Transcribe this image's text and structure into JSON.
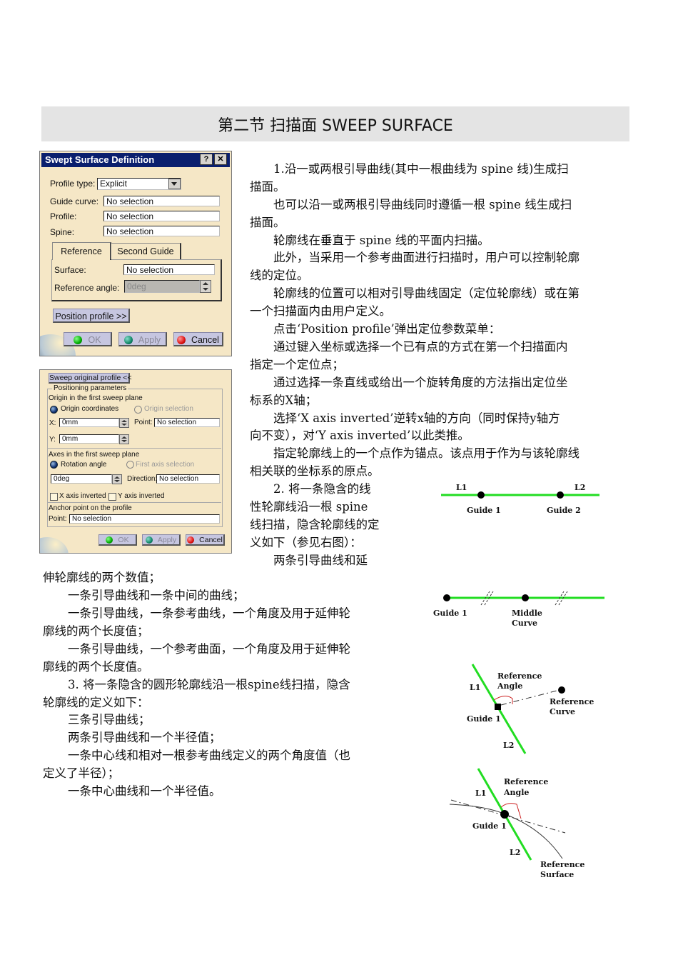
{
  "section_title": "第二节 扫描面 SWEEP SURFACE",
  "dialog1": {
    "title": "Swept Surface Definition",
    "help_button": "?",
    "close_button": "✕",
    "profile_type_label": "Profile type:",
    "profile_type_value": "Explicit",
    "guide_curve_label": "Guide curve:",
    "guide_curve_value": "No selection",
    "profile_label": "Profile:",
    "profile_value": "No selection",
    "spine_label": "Spine:",
    "spine_value": "No selection",
    "tabs": [
      {
        "label": "Reference",
        "active": true
      },
      {
        "label": "Second Guide",
        "active": false
      }
    ],
    "surface_label": "Surface:",
    "surface_value": "No selection",
    "ref_angle_label": "Reference angle:",
    "ref_angle_value": "0deg",
    "position_profile_button": "Position profile >>",
    "ok_button": "OK",
    "apply_button": "Apply",
    "cancel_button": "Cancel"
  },
  "dialog2": {
    "sweep_original_button": "Sweep original profile <<",
    "positioning_group": "Positioning parameters",
    "origin_heading": "Origin in the first sweep plane",
    "origin_coordinates_label": "Origin coordinates",
    "origin_selection_label": "Origin selection",
    "x_label": "X:",
    "x_value": "0mm",
    "y_label": "Y:",
    "y_value": "0mm",
    "point_label": "Point:",
    "point_value": "No selection",
    "axes_heading": "Axes in the first sweep plane",
    "rotation_angle_label": "Rotation angle",
    "first_axis_selection_label": "First axis selection",
    "angle_value": "0deg",
    "direction_label": "Direction:",
    "direction_value": "No selection",
    "x_inverted_label": "X axis inverted",
    "y_inverted_label": "Y axis inverted",
    "anchor_heading": "Anchor point on the profile",
    "anchor_point_label": "Point:",
    "anchor_point_value": "No selection",
    "ok_button": "OK",
    "apply_button": "Apply",
    "cancel_button": "Cancel"
  },
  "text": {
    "p1a": "1.沿一或两根引导曲线(其中一根曲线为 spine 线)生成扫",
    "p1b": "描面。",
    "p2a": "也可以沿一或两根引导曲线同时遵循一根 spine 线生成扫",
    "p2b": "描面。",
    "p3": "轮廓线在垂直于 spine 线的平面内扫描。",
    "p4a": "此外，当采用一个参考曲面进行扫描时，用户可以控制轮廓",
    "p4b": "线的定位。",
    "p5a": "轮廓线的位置可以相对引导曲线固定（定位轮廓线）或在第",
    "p5b": "一个扫描面内由用户定义。",
    "p6": "点击‘Position profile’弹出定位参数菜单：",
    "p7a": "通过键入坐标或选择一个已有点的方式在第一个扫描面内",
    "p7b": "指定一个定位点；",
    "p8a": "通过选择一条直线或给出一个旋转角度的方法指出定位坐",
    "p8b": "标系的X轴；",
    "p9a": "选择‘X axis inverted’逆转x轴的方向（同时保持y轴方",
    "p9b": "向不变），对‘Y axis inverted’以此类推。",
    "p10a": "指定轮廓线上的一个点作为锚点。该点用于作为与该轮廓线",
    "p10b": "相关联的坐标系的原点。",
    "p11a": "2. 将一条隐含的线",
    "p11b": "性轮廓线沿一根 spine",
    "p11c": "线扫描，隐含轮廓线的定",
    "p11d": "义如下（参见右图）：",
    "p12a": "两条引导曲线和延",
    "p12b": "伸轮廓线的两个数值；",
    "p13": "一条引导曲线和一条中间的曲线；",
    "p14a": "一条引导曲线，一条参考曲线，一个角度及用于延伸轮",
    "p14b": "廓线的两个长度值；",
    "p15a": "一条引导曲线，一个参考曲面，一个角度及用于延伸轮",
    "p15b": "廓线的两个长度值。",
    "p16a": "3. 将一条隐含的圆形轮廓线沿一根spine线扫描，隐含",
    "p16b": "轮廓线的定义如下：",
    "p17": "三条引导曲线；",
    "p18": "两条引导曲线和一个半径值；",
    "p19a": "一条中心线和相对一根参考曲线定义的两个角度值（也",
    "p19b": "定义了半径）；",
    "p20": "一条中心曲线和一个半径值。"
  },
  "diagrams": {
    "d1": {
      "l1": "L1",
      "l2": "L2",
      "guide1": "Guide 1",
      "guide2": "Guide 2"
    },
    "d2": {
      "guide1": "Guide 1",
      "middle1": "Middle",
      "middle2": "Curve"
    },
    "d3": {
      "ref_angle1": "Reference",
      "ref_angle2": "Angle",
      "l1": "L1",
      "guide1": "Guide 1",
      "l2": "L2",
      "ref_curve1": "Reference",
      "ref_curve2": "Curve"
    },
    "d4": {
      "ref_angle1": "Reference",
      "ref_angle2": "Angle",
      "l1": "L1",
      "guide1": "Guide 1",
      "l2": "L2",
      "ref_surface1": "Reference",
      "ref_surface2": "Surface"
    },
    "line_color": "#22dd22",
    "angle_color": "#cc2222"
  }
}
